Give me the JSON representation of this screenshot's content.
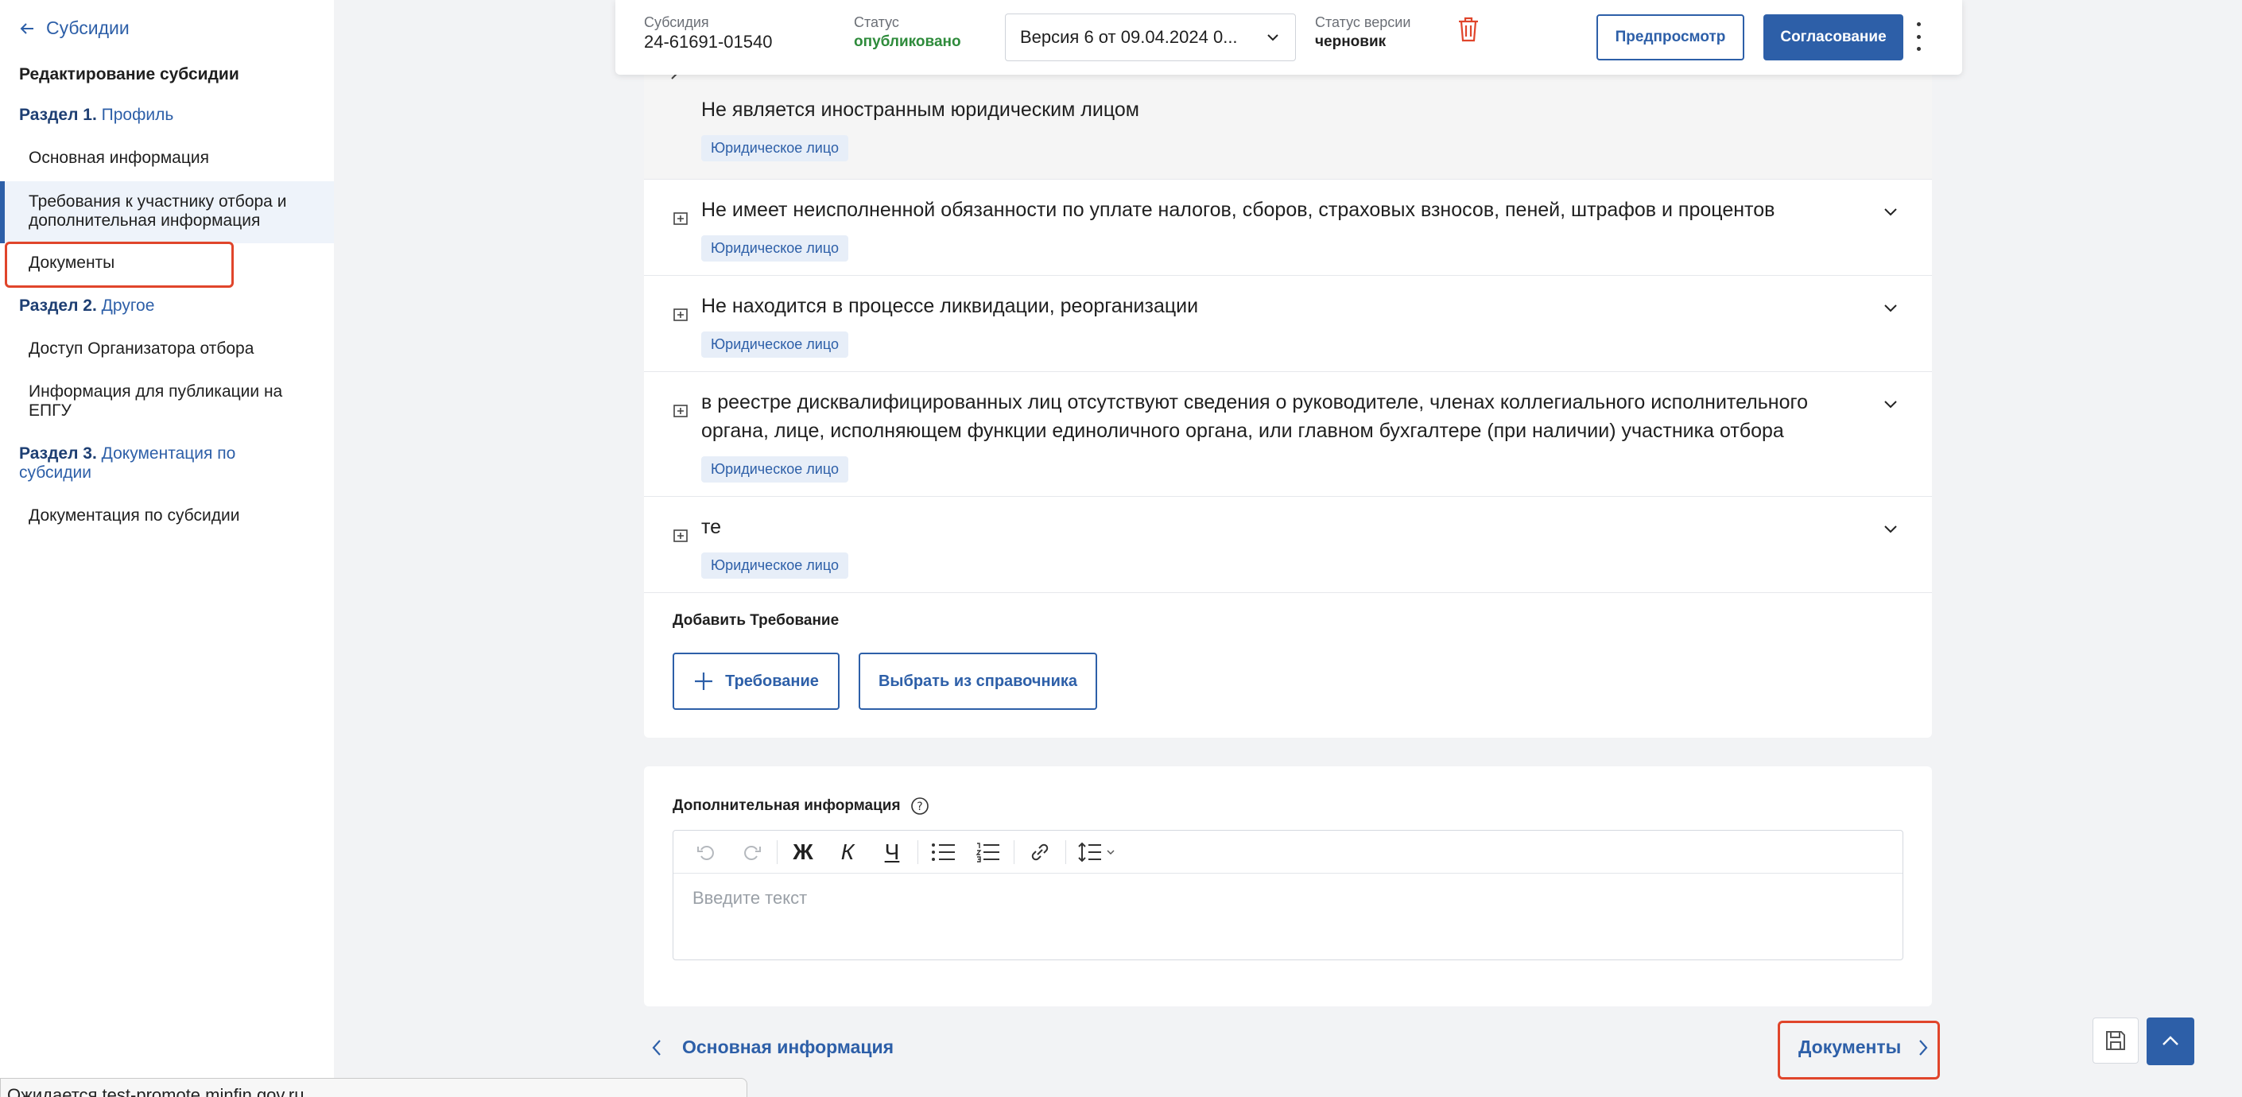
{
  "sidebar": {
    "back_label": "Субсидии",
    "title": "Редактирование субсидии",
    "section1": {
      "prefix": "Раздел 1.",
      "label": "Профиль"
    },
    "items1": [
      "Основная информация",
      "Требования к участнику отбора и дополнительная информация",
      "Документы"
    ],
    "section2": {
      "prefix": "Раздел 2.",
      "label": "Другое"
    },
    "items2": [
      "Доступ Организатора отбора",
      "Информация для публикации на ЕПГУ"
    ],
    "section3": {
      "prefix": "Раздел 3.",
      "label": "Документация по субсидии"
    },
    "items3": [
      "Документация по субсидии"
    ]
  },
  "header": {
    "subsidy_label": "Субсидия",
    "subsidy_value": "24-61691-01540",
    "status_label": "Статус",
    "status_value": "опубликовано",
    "version_select": "Версия 6 от 09.04.2024 0...",
    "version_status_label": "Статус версии",
    "version_status_value": "черновик",
    "preview_button": "Предпросмотр",
    "approve_button": "Согласование"
  },
  "requirements": {
    "items": [
      {
        "text": "Не является иностранным юридическим лицом",
        "tag": "Юридическое лицо"
      },
      {
        "text": "Не имеет неисполненной обязанности по уплате налогов, сборов, страховых взносов, пеней, штрафов и процентов",
        "tag": "Юридическое лицо"
      },
      {
        "text": "Не находится в процессе ликвидации, реорганизации",
        "tag": "Юридическое лицо"
      },
      {
        "text": "в реестре дисквалифицированных лиц отсутствуют сведения о руководителе, членах коллегиального исполнительного органа, лице, исполняющем функции единоличного органа, или главном бухгалтере (при наличии) участника отбора",
        "tag": "Юридическое лицо"
      },
      {
        "text": "те",
        "tag": "Юридическое лицо"
      }
    ],
    "add_title": "Добавить Требование",
    "add_button": "Требование",
    "pick_button": "Выбрать из справочника"
  },
  "additional": {
    "title": "Дополнительная информация",
    "placeholder": "Введите текст",
    "toolbar": {
      "bold": "Ж",
      "italic": "К",
      "underline": "Ч"
    }
  },
  "nav": {
    "prev": "Основная информация",
    "next": "Документы"
  },
  "statusbar": "Ожидается test-promote.minfin.gov.ru...",
  "colors": {
    "accent": "#2d5fa8",
    "highlight": "#e0452b",
    "status_ok": "#2e8b3b",
    "danger": "#e0452b"
  }
}
